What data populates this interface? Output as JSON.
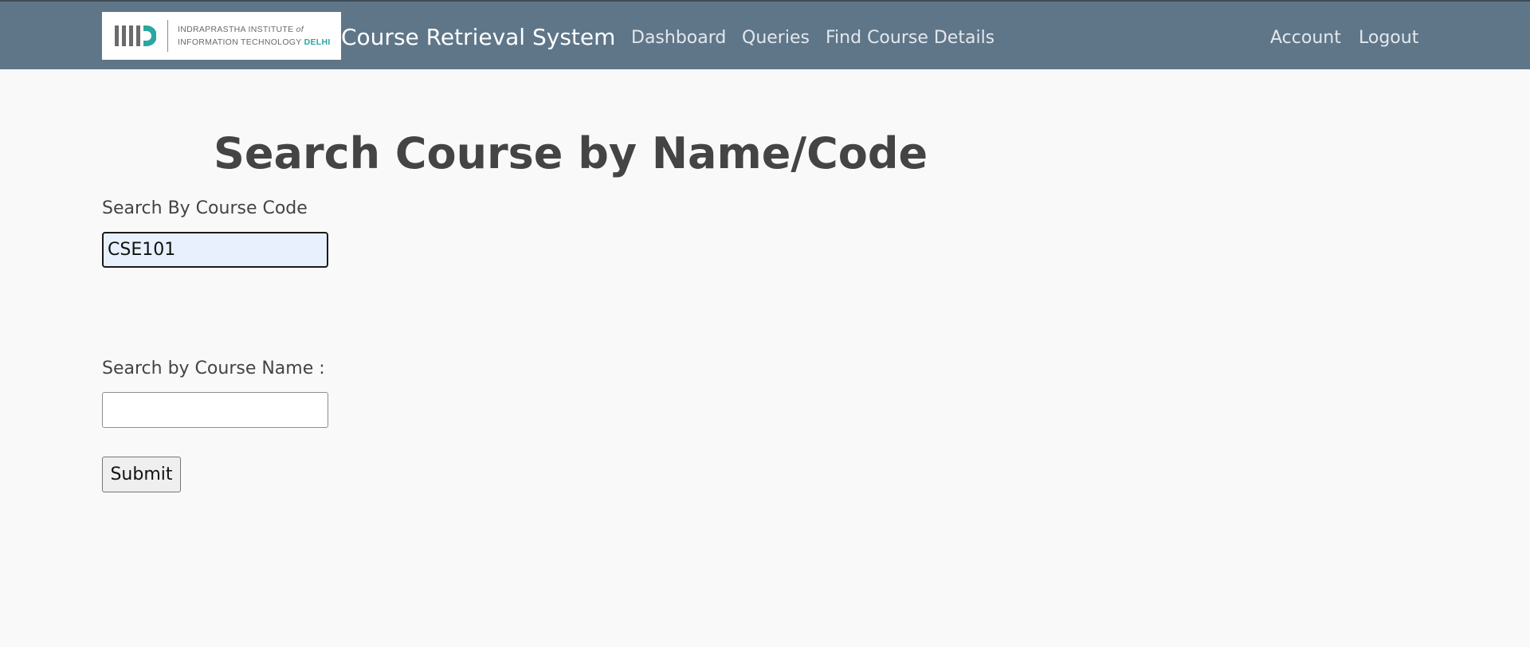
{
  "header": {
    "logo": {
      "line1": "INDRAPRASTHA INSTITUTE",
      "of": "of",
      "line2": "INFORMATION TECHNOLOGY",
      "delhi": "DELHI"
    },
    "brand": "Course Retrieval System",
    "nav": {
      "dashboard": "Dashboard",
      "queries": "Queries",
      "find_course_details": "Find Course Details",
      "account": "Account",
      "logout": "Logout"
    }
  },
  "main": {
    "title": "Search Course by Name/Code",
    "code_search": {
      "label": "Search By Course Code",
      "value": "CSE101"
    },
    "name_search": {
      "label": "Search by Course Name :",
      "value": ""
    },
    "submit_label": "Submit"
  },
  "colors": {
    "header_bg": "#5f7689",
    "page_bg": "#f9f9f9",
    "autofill_bg": "#e8f0fe",
    "logo_accent": "#2aa7a1"
  }
}
